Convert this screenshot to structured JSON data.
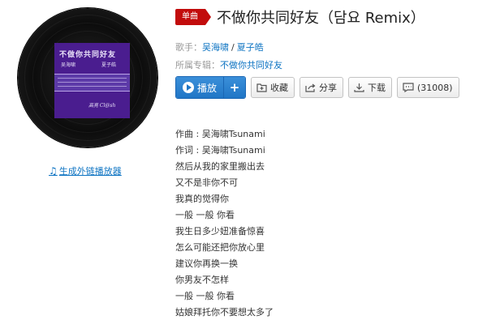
{
  "badge": "单曲",
  "song": {
    "title": "不做你共同好友（담요 Remix）"
  },
  "singer": {
    "label": "歌手：",
    "artists": [
      "吴海啸",
      "夏子皓"
    ],
    "separator": "/"
  },
  "album": {
    "label": "所属专辑：",
    "name": "不做你共同好友"
  },
  "cover": {
    "title": "不做你共同好友",
    "line_left": "吴海啸",
    "line_right": "夏子皓",
    "signature": "高亮 Cl@sh",
    "colors": {
      "background": "#4a1d8f",
      "band": "#5c3aa8"
    }
  },
  "external_player_link": {
    "icon": "music-note-icon",
    "label": "生成外链播放器"
  },
  "actions": {
    "play": "播放",
    "add": "+",
    "collect": "收藏",
    "share": "分享",
    "download": "下载",
    "comment": "(31008)"
  },
  "lyrics": [
    "作曲 : 吴海啸Tsunami",
    "作词 : 吴海啸Tsunami",
    "然后从我的家里搬出去",
    "又不是非你不可",
    "我真的觉得你",
    "一般 一般 你看",
    "我生日多少妞准备惊喜",
    "怎么可能还把你放心里",
    "建议你再换一换",
    "你男友不怎样",
    "一般 一般 你看",
    "姑娘拜托你不要想太多了"
  ],
  "colors": {
    "accent": "#c20c0c",
    "link": "#0c73c2",
    "play_button": "#2076c6"
  }
}
